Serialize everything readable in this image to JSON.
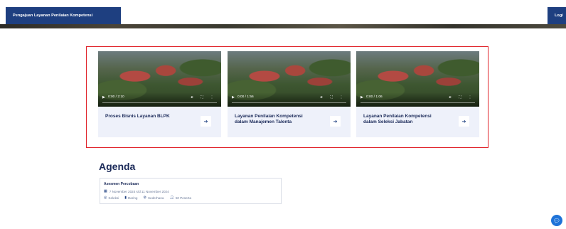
{
  "nav": {
    "left_label": "Pengajuan Layanan Penilaian Kompetensi",
    "right_label": "Logi"
  },
  "videos": [
    {
      "time": "0:00 / 2:10",
      "title": "Proses Bisnis Layanan BLPK"
    },
    {
      "time": "0:00 / 1:56",
      "title": "Layanan Penilaian Kompetensi dalam Manajemen Talenta"
    },
    {
      "time": "0:00 / 1:06",
      "title": "Layanan Penilaian Kompetensi dalam Seleksi Jabatan"
    }
  ],
  "agenda": {
    "heading": "Agenda",
    "item": {
      "title": "Asesmen Percobaan",
      "date": "7 November 2024 s/d 11 November 2024",
      "type": "Seleksi",
      "mode": "Daring",
      "method": "Sederhana",
      "participants": "50 Peserta"
    }
  },
  "icons": {
    "play": "play-icon",
    "volume": "volume-icon",
    "fullscreen": "fullscreen-icon",
    "more": "more-vertical-icon",
    "arrow": "arrow-right-icon",
    "calendar": "calendar-icon",
    "target": "target-icon",
    "book": "book-icon",
    "cogs": "cogs-icon",
    "user": "user-icon",
    "chat": "chat-icon"
  },
  "colors": {
    "primary": "#1e3f80",
    "highlight_border": "#e0242b",
    "card_bg": "#eef1fa"
  }
}
